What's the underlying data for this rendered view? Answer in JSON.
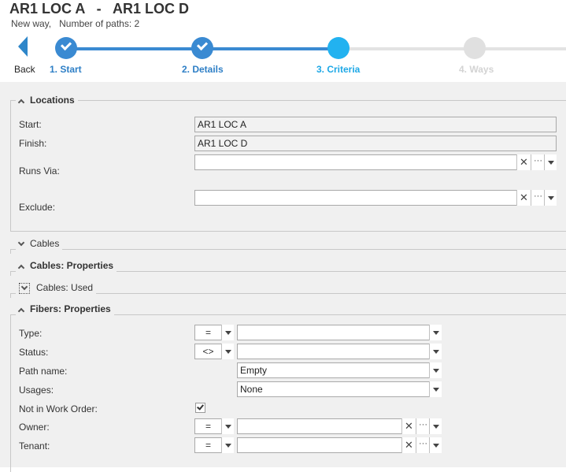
{
  "header": {
    "title": "AR1 LOC A   -   AR1 LOC D",
    "subtitle": "New way,   Number of paths: 2",
    "back_label": "Back"
  },
  "wizard": {
    "steps": [
      {
        "label": "1. Start",
        "state": "done"
      },
      {
        "label": "2. Details",
        "state": "done"
      },
      {
        "label": "3. Criteria",
        "state": "active"
      },
      {
        "label": "4. Ways",
        "state": "disabled"
      }
    ]
  },
  "groups": {
    "locations": {
      "title": "Locations",
      "expanded": true,
      "fields": {
        "start": {
          "label": "Start:",
          "value": "AR1 LOC A"
        },
        "finish": {
          "label": "Finish:",
          "value": "AR1 LOC D"
        },
        "runs_via": {
          "label": "Runs Via:",
          "value": ""
        },
        "exclude": {
          "label": "Exclude:",
          "value": ""
        }
      }
    },
    "cables": {
      "title": "Cables",
      "expanded": false
    },
    "cables_properties": {
      "title": "Cables: Properties",
      "expanded": true
    },
    "cables_used": {
      "title": "Cables: Used",
      "expanded": false
    },
    "fibers_properties": {
      "title": "Fibers: Properties",
      "expanded": true,
      "fields": {
        "type": {
          "label": "Type:",
          "operator": "=",
          "value": ""
        },
        "status": {
          "label": "Status:",
          "operator": "<>",
          "value": ""
        },
        "path_name": {
          "label": "Path name:",
          "value": "Empty"
        },
        "usages": {
          "label": "Usages:",
          "value": "None"
        },
        "not_in_work_order": {
          "label": "Not in Work Order:",
          "checked": true
        },
        "owner": {
          "label": "Owner:",
          "operator": "=",
          "value": ""
        },
        "tenant": {
          "label": "Tenant:",
          "operator": "=",
          "value": ""
        }
      }
    }
  },
  "icons": {
    "clear": "✕",
    "ellipsis": "···"
  },
  "colors": {
    "step_done": "#3a8ad2",
    "step_active": "#22b2f0",
    "step_disabled": "#e0e0e0"
  }
}
